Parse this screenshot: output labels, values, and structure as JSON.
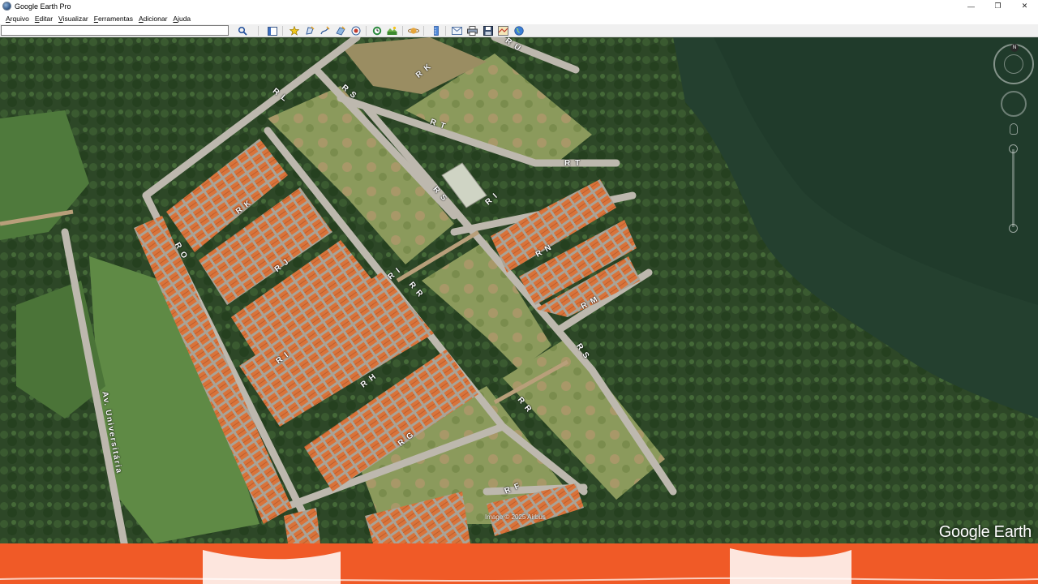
{
  "window": {
    "title": "Google Earth Pro",
    "controls": [
      "—",
      "❐",
      "✕"
    ]
  },
  "menu": [
    {
      "label": "Arquivo",
      "key": "A",
      "rest": "rquivo"
    },
    {
      "label": "Editar",
      "key": "E",
      "rest": "ditar"
    },
    {
      "label": "Visualizar",
      "key": "V",
      "rest": "isualizar"
    },
    {
      "label": "Ferramentas",
      "key": "F",
      "rest": "erramentas"
    },
    {
      "label": "Adicionar",
      "key": "A",
      "rest": "dicionar"
    },
    {
      "label": "Ajuda",
      "key": "A",
      "rest": "juda"
    }
  ],
  "search": {
    "value": "",
    "placeholder": ""
  },
  "toolbar_icons": [
    "search-icon",
    "sidebar-toggle-icon",
    "placemark-icon",
    "polygon-icon",
    "path-icon",
    "image-overlay-icon",
    "record-tour-icon",
    "historical-imagery-icon",
    "sunlight-icon",
    "planets-icon",
    "ruler-icon",
    "email-icon",
    "print-icon",
    "save-image-icon",
    "view-in-maps-icon",
    "earth-icon"
  ],
  "map": {
    "streets": [
      {
        "label": "R U"
      },
      {
        "label": "R K"
      },
      {
        "label": "R L"
      },
      {
        "label": "R S"
      },
      {
        "label": "R T"
      },
      {
        "label": "R T"
      },
      {
        "label": "R S"
      },
      {
        "label": "R I"
      },
      {
        "label": "R K"
      },
      {
        "label": "R O"
      },
      {
        "label": "R J"
      },
      {
        "label": "R N"
      },
      {
        "label": "R M"
      },
      {
        "label": "R I"
      },
      {
        "label": "R R"
      },
      {
        "label": "R I"
      },
      {
        "label": "R H"
      },
      {
        "label": "R G"
      },
      {
        "label": "R R"
      },
      {
        "label": "R S"
      },
      {
        "label": "R F"
      },
      {
        "label": "Av. Universitária"
      }
    ],
    "credit": "Image © 2025 Airbus",
    "watermark": "Google Earth"
  },
  "colors": {
    "banner": "#f05a27",
    "forest": "#2f4a2a",
    "roofs": "#d9733a",
    "lake": "#24402f"
  }
}
